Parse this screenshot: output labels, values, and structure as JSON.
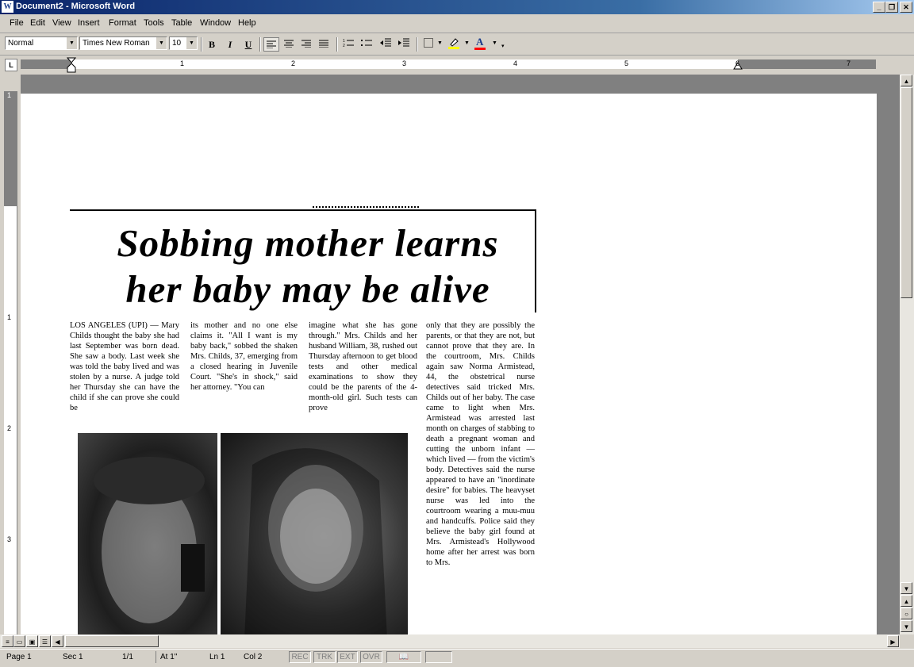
{
  "window": {
    "title": "Document2 - Microsoft Word",
    "app_icon": "W"
  },
  "menu": [
    "File",
    "Edit",
    "View",
    "Insert",
    "Format",
    "Tools",
    "Table",
    "Window",
    "Help"
  ],
  "toolbar": {
    "style": "Normal",
    "font": "Times New Roman",
    "size": "10",
    "bold": "B",
    "italic": "I",
    "underline": "U",
    "font_color_label": "A",
    "highlight_color": "#ffff00",
    "font_color": "#ff0000"
  },
  "ruler": {
    "tab_selector": "L",
    "numbers": [
      "1",
      "2",
      "3",
      "4",
      "5",
      "6",
      "7"
    ],
    "vnumbers": [
      "1",
      "1",
      "2",
      "3"
    ]
  },
  "article": {
    "headline_1": "Sobbing mother learns",
    "headline_2": "her baby may be alive",
    "col1": "LOS ANGELES (UPI) — Mary Childs thought the baby she had last September was born dead. She saw a body. Last week she was told the baby lived and was stolen by a nurse. A judge told her Thursday she can have the child if she can prove she could be",
    "col2": "its mother and no one else claims it. \"All I want is my baby back,\" sobbed the shaken Mrs. Childs, 37, emerging from a closed hearing in Juvenile Court. \"She's in shock,\" said her attorney. \"You can",
    "col3": "imagine what she has gone through.\" Mrs. Childs and her husband William, 38, rushed out Thursday afternoon to get blood tests and other medical examinations to show they could be the parents of the 4-month-old girl. Such tests can prove",
    "col4": "only that they are possibly the parents, or that they are not, but cannot prove that they are. In the courtroom, Mrs. Childs again saw Norma Armistead, 44, the obstetrical nurse detectives said tricked Mrs. Childs out of her baby. The case came to light when Mrs. Armistead was arrested last month on charges of stabbing to death a pregnant woman and cutting the unborn infant — which lived — from the victim's body. Detectives said the nurse appeared to have an \"inordinate desire\" for babies. The heavyset nurse was led into the courtroom wearing a muu-muu and handcuffs. Police said they believe the baby girl found at Mrs. Armistead's Hollywood home after her arrest was born to Mrs."
  },
  "status": {
    "page": "Page  1",
    "sec": "Sec  1",
    "pages": "1/1",
    "at": "At  1\"",
    "ln": "Ln  1",
    "col": "Col  2",
    "rec": "REC",
    "trk": "TRK",
    "ext": "EXT",
    "ovr": "OVR"
  }
}
